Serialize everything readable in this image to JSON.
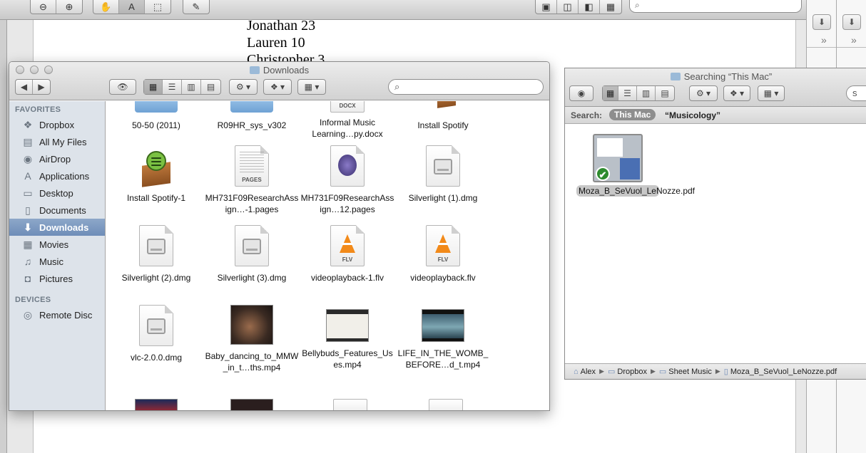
{
  "background_doc": {
    "lines": [
      "Jonathan 23",
      "Lauren 10",
      "Christopher 3"
    ]
  },
  "background_toolbar": {
    "zoom_out": "⊖",
    "zoom_in": "⊕",
    "hand": "✋",
    "text": "A",
    "select": "⬚",
    "annotate": "✎",
    "view1": "▣",
    "view2": "◫",
    "view3": "◧",
    "view4": "▦",
    "search_glyph": "⌕"
  },
  "downloads_window": {
    "title": "Downloads",
    "nav_back": "◀",
    "nav_forward": "▶",
    "quicklook": "👁",
    "view_icon": "▦",
    "view_list": "☰",
    "view_column": "▥",
    "view_coverflow": "▤",
    "action": "⚙ ▾",
    "dropbox": "❖ ▾",
    "arrange": "▦ ▾",
    "search_glyph": "⌕",
    "sidebar": {
      "favorites_header": "FAVORITES",
      "devices_header": "DEVICES",
      "favorites": [
        {
          "label": "Dropbox",
          "icon": "❖"
        },
        {
          "label": "All My Files",
          "icon": "▤"
        },
        {
          "label": "AirDrop",
          "icon": "◉"
        },
        {
          "label": "Applications",
          "icon": "A"
        },
        {
          "label": "Desktop",
          "icon": "▭"
        },
        {
          "label": "Documents",
          "icon": "▯"
        },
        {
          "label": "Downloads",
          "icon": "⬇"
        },
        {
          "label": "Movies",
          "icon": "▦"
        },
        {
          "label": "Music",
          "icon": "♫"
        },
        {
          "label": "Pictures",
          "icon": "◘"
        }
      ],
      "devices": [
        {
          "label": "Remote Disc",
          "icon": "◎"
        }
      ]
    },
    "files": [
      {
        "name": "50-50 (2011)",
        "kind": "folder"
      },
      {
        "name": "R09HR_sys_v302",
        "kind": "folder"
      },
      {
        "name": "Informal Music Learning…py.docx",
        "kind": "docx",
        "tag": "DOCX"
      },
      {
        "name": "Install Spotify",
        "kind": "box-partial"
      },
      {
        "name": "Install Spotify-1",
        "kind": "box"
      },
      {
        "name": "MH731F09ResearchAssign…-1.pages",
        "kind": "pages",
        "tag": "PAGES"
      },
      {
        "name": "MH731F09ResearchAssign…12.pages",
        "kind": "pages2"
      },
      {
        "name": "Silverlight (1).dmg",
        "kind": "dmg"
      },
      {
        "name": "Silverlight (2).dmg",
        "kind": "dmg"
      },
      {
        "name": "Silverlight (3).dmg",
        "kind": "dmg"
      },
      {
        "name": "videoplayback-1.flv",
        "kind": "flv",
        "tag": "FLV"
      },
      {
        "name": "videoplayback.flv",
        "kind": "flv",
        "tag": "FLV"
      },
      {
        "name": "vlc-2.0.0.dmg",
        "kind": "dmg"
      },
      {
        "name": "Baby_dancing_to_MMW_in_t…ths.mp4",
        "kind": "vid-baby"
      },
      {
        "name": "Bellybuds_Features_Uses.mp4",
        "kind": "vid-belly"
      },
      {
        "name": "LIFE_IN_THE_WOMB_BEFORE…d_t.mp4",
        "kind": "vid-womb"
      }
    ]
  },
  "search_window": {
    "title": "Searching “This Mac”",
    "search_label": "Search:",
    "scope": "This Mac",
    "term": "“Musicology”",
    "search_field_partial": "s",
    "result": {
      "name": "Moza_B_SeVuol_LeNozze.pdf",
      "check": "✔"
    },
    "path": [
      {
        "label": "Alex",
        "icon": "⌂"
      },
      {
        "label": "Dropbox",
        "icon": "▭"
      },
      {
        "label": "Sheet Music",
        "icon": "▭"
      },
      {
        "label": "Moza_B_SeVuol_LeNozze.pdf",
        "icon": "▯"
      }
    ],
    "path_separator": "▶"
  },
  "right_panel": {
    "button_glyph": "⬇",
    "chevron": "»"
  }
}
